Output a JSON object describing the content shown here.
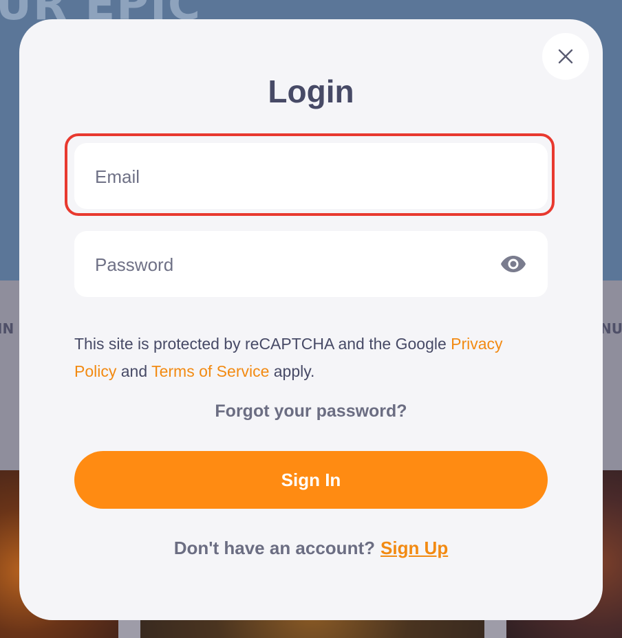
{
  "background": {
    "hero_text": "UR EPIC",
    "left_label": "IN",
    "right_label": "NU"
  },
  "modal": {
    "title": "Login",
    "close_icon": "close-icon",
    "email": {
      "placeholder": "Email",
      "value": ""
    },
    "password": {
      "placeholder": "Password",
      "value": "",
      "toggle_icon": "eye-icon"
    },
    "notice": {
      "prefix": "This site is protected by reCAPTCHA and the Google ",
      "privacy_link": "Privacy Policy",
      "middle": " and ",
      "terms_link": "Terms of Service",
      "suffix": " apply."
    },
    "forgot_password": "Forgot your password?",
    "sign_in_label": "Sign In",
    "signup_prompt": "Don't have an account?",
    "signup_link": "Sign Up"
  },
  "colors": {
    "accent": "#ff8b12",
    "link": "#f28a12",
    "title": "#474a66",
    "highlight": "#e8392f",
    "modal_bg": "#f5f5f8"
  }
}
